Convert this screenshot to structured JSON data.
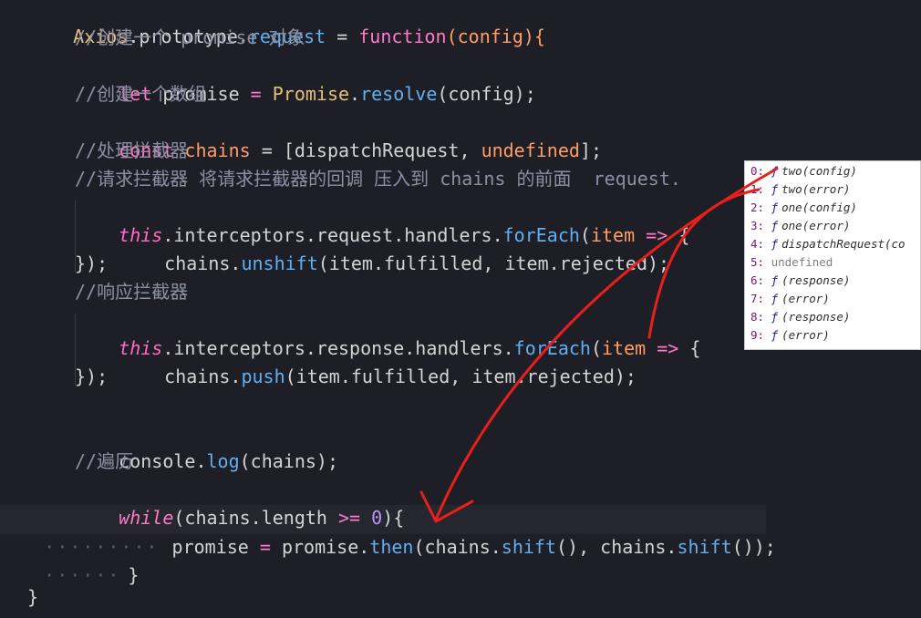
{
  "code": {
    "line0": {
      "a": "Axios",
      "b": ".prototype.",
      "c": "request",
      "d": " = ",
      "e": "function",
      "f": "(config){"
    },
    "line1": {
      "comment": "//创建一个 promise 对象"
    },
    "line2": {
      "kw": "let",
      "v": " promise ",
      "eq": "=",
      "cls": " Promise",
      "dot": ".",
      "fn": "resolve",
      "rest": "(config);"
    },
    "line3": {
      "comment": "//创建一个数组"
    },
    "line4": {
      "kw": "const",
      "v": " chains",
      "eq": " = ",
      "a": "[dispatchRequest, ",
      "u": "undefined",
      "b": "];"
    },
    "line5": {
      "comment": "//处理拦截器"
    },
    "line6": {
      "comment": "//请求拦截器 将请求拦截器的回调 压入到 chains 的前面  request."
    },
    "line7": {
      "this": "this",
      "a": ".interceptors.request.handlers.",
      "fn": "forEach",
      "b": "(",
      "item": "item",
      "arrow": " => ",
      "c": "{"
    },
    "line8": {
      "a": "chains.",
      "fn": "unshift",
      "b": "(item.fulfilled, item.rejected);"
    },
    "line9": {
      "a": "});"
    },
    "line10": {
      "comment": "//响应拦截器"
    },
    "line11": {
      "this": "this",
      "a": ".interceptors.response.handlers.",
      "fn": "forEach",
      "b": "(",
      "item": "item",
      "arrow": " => ",
      "c": "{"
    },
    "line12": {
      "a": "chains.",
      "fn": "push",
      "b": "(item.fulfilled, item.rejected);"
    },
    "line13": {
      "a": "});"
    },
    "line15": {
      "a": "console.",
      "fn": "log",
      "b": "(chains);"
    },
    "line16": {
      "comment": "//遍历"
    },
    "line17": {
      "kw": "while",
      "a": "(chains.length ",
      "op": ">=",
      "sp": " ",
      "num": "0",
      "b": "){"
    },
    "line18": {
      "dots": "·········",
      "a": "promise ",
      "eq": "=",
      "b": " promise.",
      "fn": "then",
      "c": "(chains.",
      "fn2": "shift",
      "d": "(), chains.",
      "fn3": "shift",
      "e": "());"
    },
    "line19": {
      "dots": "······",
      "a": "}"
    },
    "line21": {
      "a": "}"
    }
  },
  "console_panel": {
    "rows": [
      {
        "index": "0:",
        "f": "ƒ",
        "text": "two(config)"
      },
      {
        "index": "1:",
        "f": "ƒ",
        "text": "two(error)"
      },
      {
        "index": "2:",
        "f": "ƒ",
        "text": "one(config)"
      },
      {
        "index": "3:",
        "f": "ƒ",
        "text": "one(error)"
      },
      {
        "index": "4:",
        "f": "ƒ",
        "text": "dispatchRequest(co"
      },
      {
        "index": "5:",
        "f": "",
        "text": "undefined"
      },
      {
        "index": "6:",
        "f": "ƒ",
        "text": "(response)"
      },
      {
        "index": "7:",
        "f": "ƒ",
        "text": "(error)"
      },
      {
        "index": "8:",
        "f": "ƒ",
        "text": "(response)"
      },
      {
        "index": "9:",
        "f": "ƒ",
        "text": "(error)"
      }
    ]
  },
  "colors": {
    "background": "#1e1f26",
    "annotation": "#e8201c",
    "panel": "#ffffff"
  }
}
